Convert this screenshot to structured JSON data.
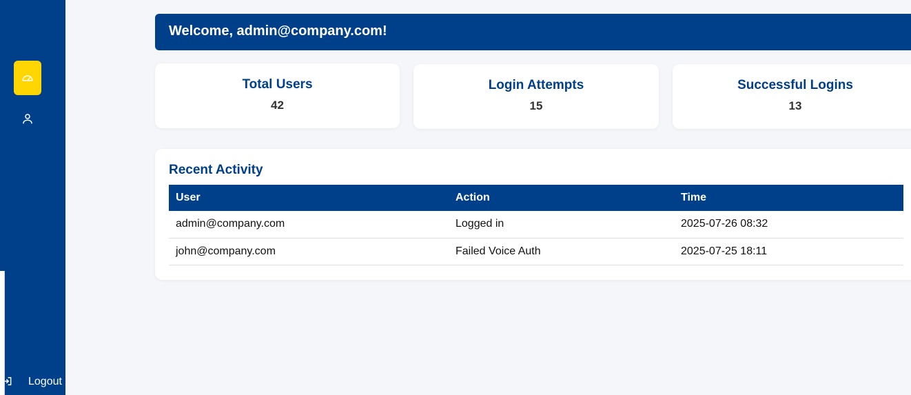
{
  "sidebar": {
    "items": [
      {
        "icon": "dashboard-gauge-icon",
        "active": true
      },
      {
        "icon": "user-icon",
        "active": false
      }
    ],
    "logout_label": "Logout",
    "logout_icon": "logout-icon",
    "colors": {
      "background": "#003f8a",
      "active": "#ffd600"
    }
  },
  "banner": {
    "welcome": "Welcome, admin@company.com!"
  },
  "stats": [
    {
      "title": "Total Users",
      "value": "42"
    },
    {
      "title": "Login Attempts",
      "value": "15"
    },
    {
      "title": "Successful Logins",
      "value": "13"
    }
  ],
  "activity": {
    "title": "Recent Activity",
    "columns": [
      "User",
      "Action",
      "Time"
    ],
    "rows": [
      [
        "admin@company.com",
        "Logged in",
        "2025-07-26 08:32"
      ],
      [
        "john@company.com",
        "Failed Voice Auth",
        "2025-07-25 18:11"
      ]
    ]
  }
}
